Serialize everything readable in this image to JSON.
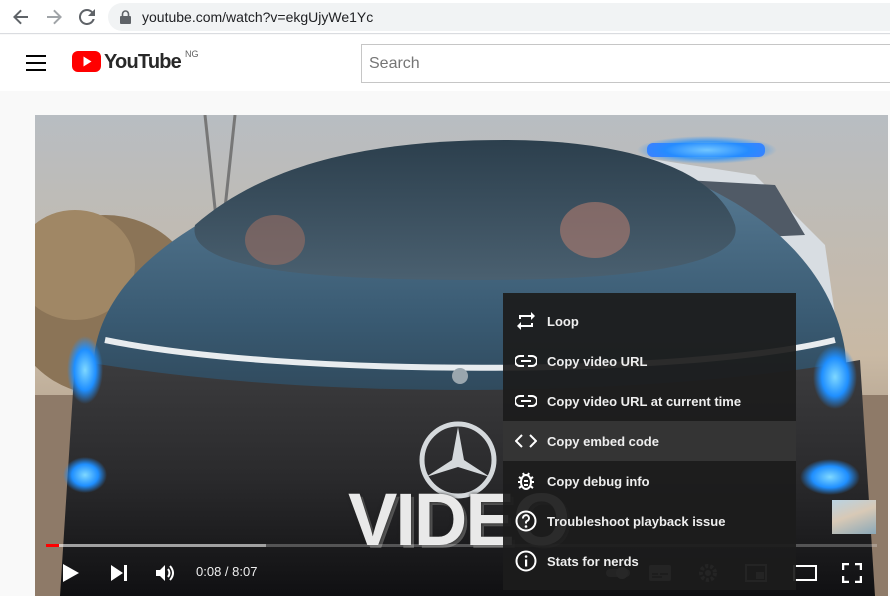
{
  "browser": {
    "url": "youtube.com/watch?v=ekgUjyWe1Yc",
    "icons": [
      "back-arrow-icon",
      "forward-arrow-icon",
      "reload-icon",
      "lock-icon"
    ]
  },
  "header": {
    "logo_text": "YouTube",
    "country_code": "NG",
    "search_placeholder": "Search"
  },
  "player": {
    "overlay_text": "VIDEO",
    "current_time": "0:08",
    "duration": "8:07",
    "time_display": "0:08 / 8:07",
    "progress_played_fraction": 0.016,
    "progress_loaded_fraction": 0.265,
    "controls": [
      "play-icon",
      "next-icon",
      "volume-icon",
      "autoplay-toggle-icon",
      "subtitles-icon",
      "settings-icon",
      "miniplayer-icon",
      "theater-icon",
      "fullscreen-icon"
    ]
  },
  "context_menu": {
    "items": [
      {
        "label": "Loop",
        "icon": "loop-icon"
      },
      {
        "label": "Copy video URL",
        "icon": "link-icon"
      },
      {
        "label": "Copy video URL at current time",
        "icon": "link-icon"
      },
      {
        "label": "Copy embed code",
        "icon": "embed-code-icon"
      },
      {
        "label": "Copy debug info",
        "icon": "bug-icon"
      },
      {
        "label": "Troubleshoot playback issue",
        "icon": "question-circle-icon"
      },
      {
        "label": "Stats for nerds",
        "icon": "info-circle-icon"
      }
    ],
    "active_index": 3
  },
  "colors": {
    "youtube_red": "#ff0000",
    "menu_bg": "#1c1c1c",
    "menu_text": "#eeeeee"
  }
}
